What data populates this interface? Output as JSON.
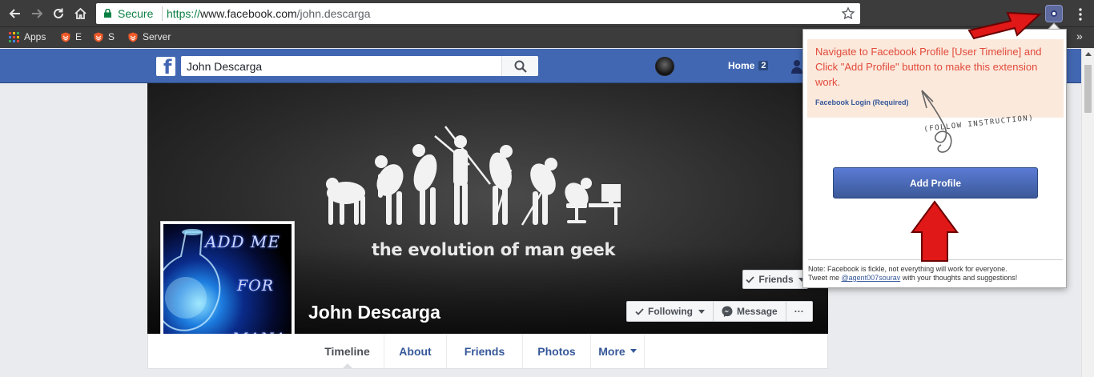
{
  "browser": {
    "secure_label": "Secure",
    "url_scheme": "https://",
    "url_host": "www.facebook.com",
    "url_path": "/john.descarga",
    "bookmarks": [
      {
        "label": "Apps",
        "icon": "apps-grid-icon"
      },
      {
        "label": "E",
        "icon": "shield-bookmark-icon"
      },
      {
        "label": "S",
        "icon": "shield-bookmark-icon"
      },
      {
        "label": "Server",
        "icon": "shield-bookmark-icon"
      }
    ],
    "bookmarks_overflow": "»"
  },
  "facebook": {
    "search_value": "John Descarga",
    "home_label": "Home",
    "home_badge": "2",
    "profile": {
      "name": "John Descarga",
      "cover_caption": "the evolution of man geek",
      "profile_picture_text": [
        "ADD ME",
        "FOR",
        "MANA"
      ],
      "friends_button": "Friends",
      "following_button": "Following",
      "message_button": "Message",
      "more_button": "···"
    },
    "tabs": [
      {
        "label": "Timeline",
        "active": true
      },
      {
        "label": "About",
        "active": false
      },
      {
        "label": "Friends",
        "active": false
      },
      {
        "label": "Photos",
        "active": false
      },
      {
        "label": "More",
        "active": false
      }
    ]
  },
  "extension_popup": {
    "instruction": "Navigate to Facebook Profile [User Timeline] and Click \"Add Profile\" button to make this extension work.",
    "login_link": "Facebook Login (Required)",
    "follow_note": "(FOLLOW INSTRUCTION)",
    "add_profile_button": "Add Profile",
    "footer_line1": "Note: Facebook is fickle, not everything will work for everyone.",
    "footer_prefix": "Tweet me ",
    "footer_handle": "@agent007sourav",
    "footer_suffix": " with your thoughts and suggestions!"
  },
  "colors": {
    "facebook_blue": "#4267b2",
    "chrome_toolbar": "#3c3c3c",
    "instruction_text": "#e24a3a",
    "instruction_bg": "#fbe9dc",
    "annotation_arrow": "#e01818"
  }
}
